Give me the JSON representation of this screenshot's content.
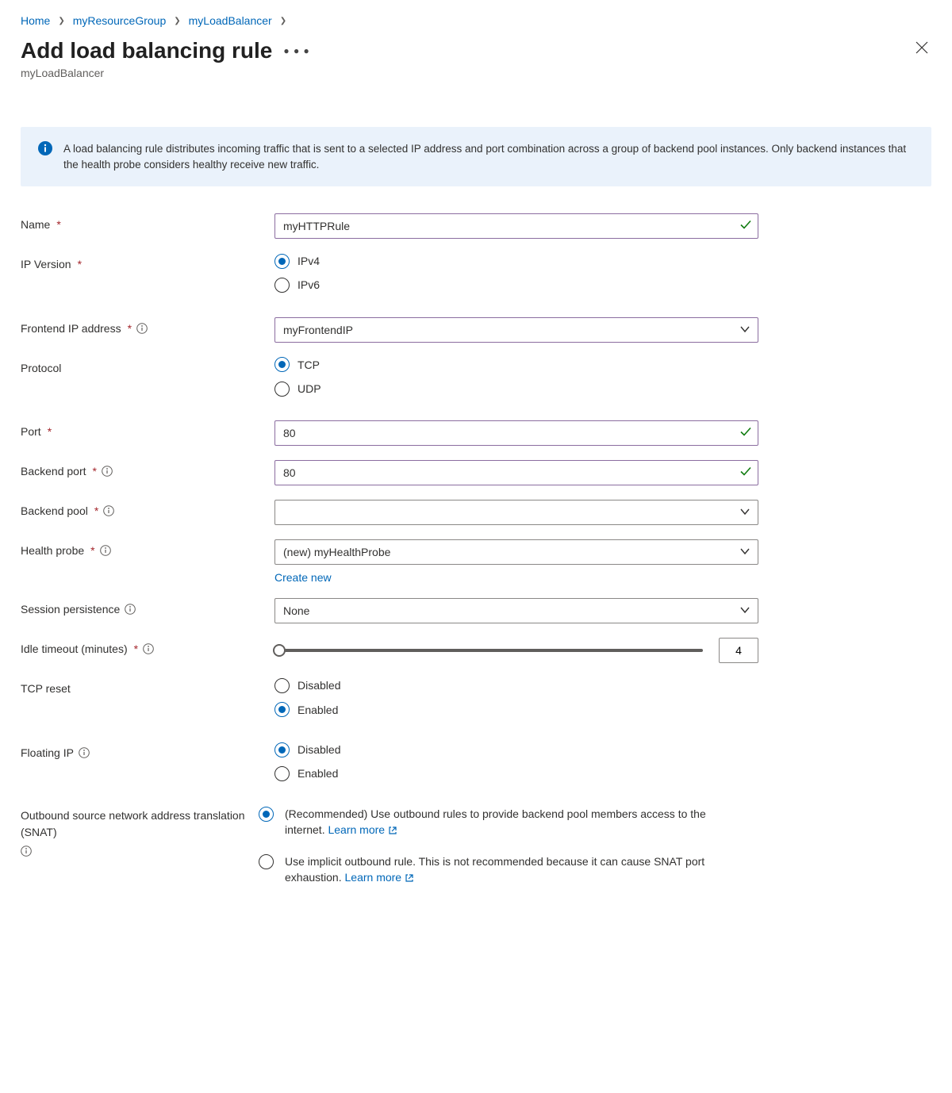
{
  "breadcrumbs": [
    "Home",
    "myResourceGroup",
    "myLoadBalancer"
  ],
  "title": "Add load balancing rule",
  "subtitle": "myLoadBalancer",
  "info": "A load balancing rule distributes incoming traffic that is sent to a selected IP address and port combination across a group of backend pool instances. Only backend instances that the health probe considers healthy receive new traffic.",
  "labels": {
    "name": "Name",
    "ipVersion": "IP Version",
    "frontendIp": "Frontend IP address",
    "protocol": "Protocol",
    "port": "Port",
    "backendPort": "Backend port",
    "backendPool": "Backend pool",
    "healthProbe": "Health probe",
    "sessionPersistence": "Session persistence",
    "idleTimeout": "Idle timeout (minutes)",
    "tcpReset": "TCP reset",
    "floatingIp": "Floating IP",
    "snat": "Outbound source network address translation (SNAT)"
  },
  "values": {
    "name": "myHTTPRule",
    "ipVersion_options": [
      "IPv4",
      "IPv6"
    ],
    "ipVersion_selected": "IPv4",
    "frontendIp": "myFrontendIP",
    "protocol_options": [
      "TCP",
      "UDP"
    ],
    "protocol_selected": "TCP",
    "port": "80",
    "backendPort": "80",
    "backendPool": "",
    "healthProbe": "(new) myHealthProbe",
    "createNew": "Create new",
    "sessionPersistence": "None",
    "idleTimeout": "4",
    "tcpReset_options": [
      "Disabled",
      "Enabled"
    ],
    "tcpReset_selected": "Enabled",
    "floatingIp_options": [
      "Disabled",
      "Enabled"
    ],
    "floatingIp_selected": "Disabled",
    "snat_options": [
      {
        "prefix": "(Recommended) Use outbound rules to provide backend pool members access to the internet. ",
        "link": "Learn more"
      },
      {
        "prefix": "Use implicit outbound rule. This is not recommended because it can cause SNAT port exhaustion. ",
        "link": "Learn more"
      }
    ],
    "snat_selected": 0
  }
}
